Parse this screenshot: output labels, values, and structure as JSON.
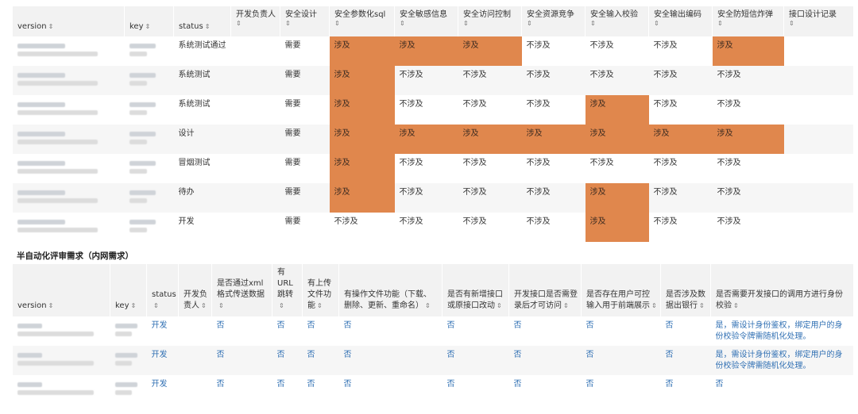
{
  "table1": {
    "sort_glyph": "⇕",
    "columns": [
      "version",
      "key",
      "status",
      "开发负责人",
      "安全设计",
      "安全参数化sql",
      "安全敏感信息",
      "安全访问控制",
      "安全资源竞争",
      "安全输入校验",
      "安全输出编码",
      "安全防短信炸弹",
      "接口设计记录"
    ],
    "rows": [
      {
        "status": "系统测试通过",
        "design": "需要",
        "vals": [
          "涉及",
          "涉及",
          "涉及",
          "不涉及",
          "不涉及",
          "不涉及",
          "涉及"
        ]
      },
      {
        "status": "系统测试",
        "design": "需要",
        "vals": [
          "涉及",
          "不涉及",
          "不涉及",
          "不涉及",
          "不涉及",
          "不涉及",
          "不涉及"
        ]
      },
      {
        "status": "系统测试",
        "design": "需要",
        "vals": [
          "涉及",
          "不涉及",
          "不涉及",
          "不涉及",
          "涉及",
          "不涉及",
          "不涉及"
        ]
      },
      {
        "status": "设计",
        "design": "需要",
        "vals": [
          "涉及",
          "涉及",
          "涉及",
          "涉及",
          "涉及",
          "涉及",
          "涉及"
        ]
      },
      {
        "status": "冒烟测试",
        "design": "需要",
        "vals": [
          "涉及",
          "不涉及",
          "不涉及",
          "不涉及",
          "不涉及",
          "不涉及",
          "不涉及"
        ]
      },
      {
        "status": "待办",
        "design": "需要",
        "vals": [
          "涉及",
          "不涉及",
          "不涉及",
          "不涉及",
          "涉及",
          "不涉及",
          "不涉及"
        ]
      },
      {
        "status": "开发",
        "design": "需要",
        "vals": [
          "不涉及",
          "不涉及",
          "不涉及",
          "不涉及",
          "涉及",
          "不涉及",
          "不涉及"
        ]
      }
    ]
  },
  "section2": {
    "title": "半自动化评审需求（内网需求）"
  },
  "table2": {
    "sort_glyph": "⇕",
    "columns": [
      "version",
      "key",
      "status",
      "开发负责人",
      "是否通过xml格式传送数据",
      "有URL跳转",
      "有上传文件功能",
      "有操作文件功能（下载、删除、更新、重命名）",
      "是否有新增接口或原接口改动",
      "开发接口是否需登录后才可访问",
      "是否存在用户可控输入用于前端展示",
      "是否涉及数据出银行",
      "是否需要开发接口的调用方进行身份校验"
    ],
    "rows": [
      {
        "status": "开发",
        "vals": [
          "否",
          "否",
          "否",
          "否",
          "否",
          "否",
          "否",
          "否"
        ],
        "last": "是，需设计身份鉴权，绑定用户的身份校验令牌需随机化处理。"
      },
      {
        "status": "开发",
        "vals": [
          "否",
          "否",
          "否",
          "否",
          "否",
          "否",
          "否",
          "否"
        ],
        "last": "是，需设计身份鉴权，绑定用户的身份校验令牌需随机化处理。"
      },
      {
        "status": "开发",
        "vals": [
          "否",
          "否",
          "否",
          "否",
          "否",
          "否",
          "否",
          "否"
        ],
        "last": "否"
      }
    ]
  },
  "colors": {
    "hot": "#e0874d",
    "link": "#2f6fb3",
    "header_bg": "#f2f2f2"
  }
}
